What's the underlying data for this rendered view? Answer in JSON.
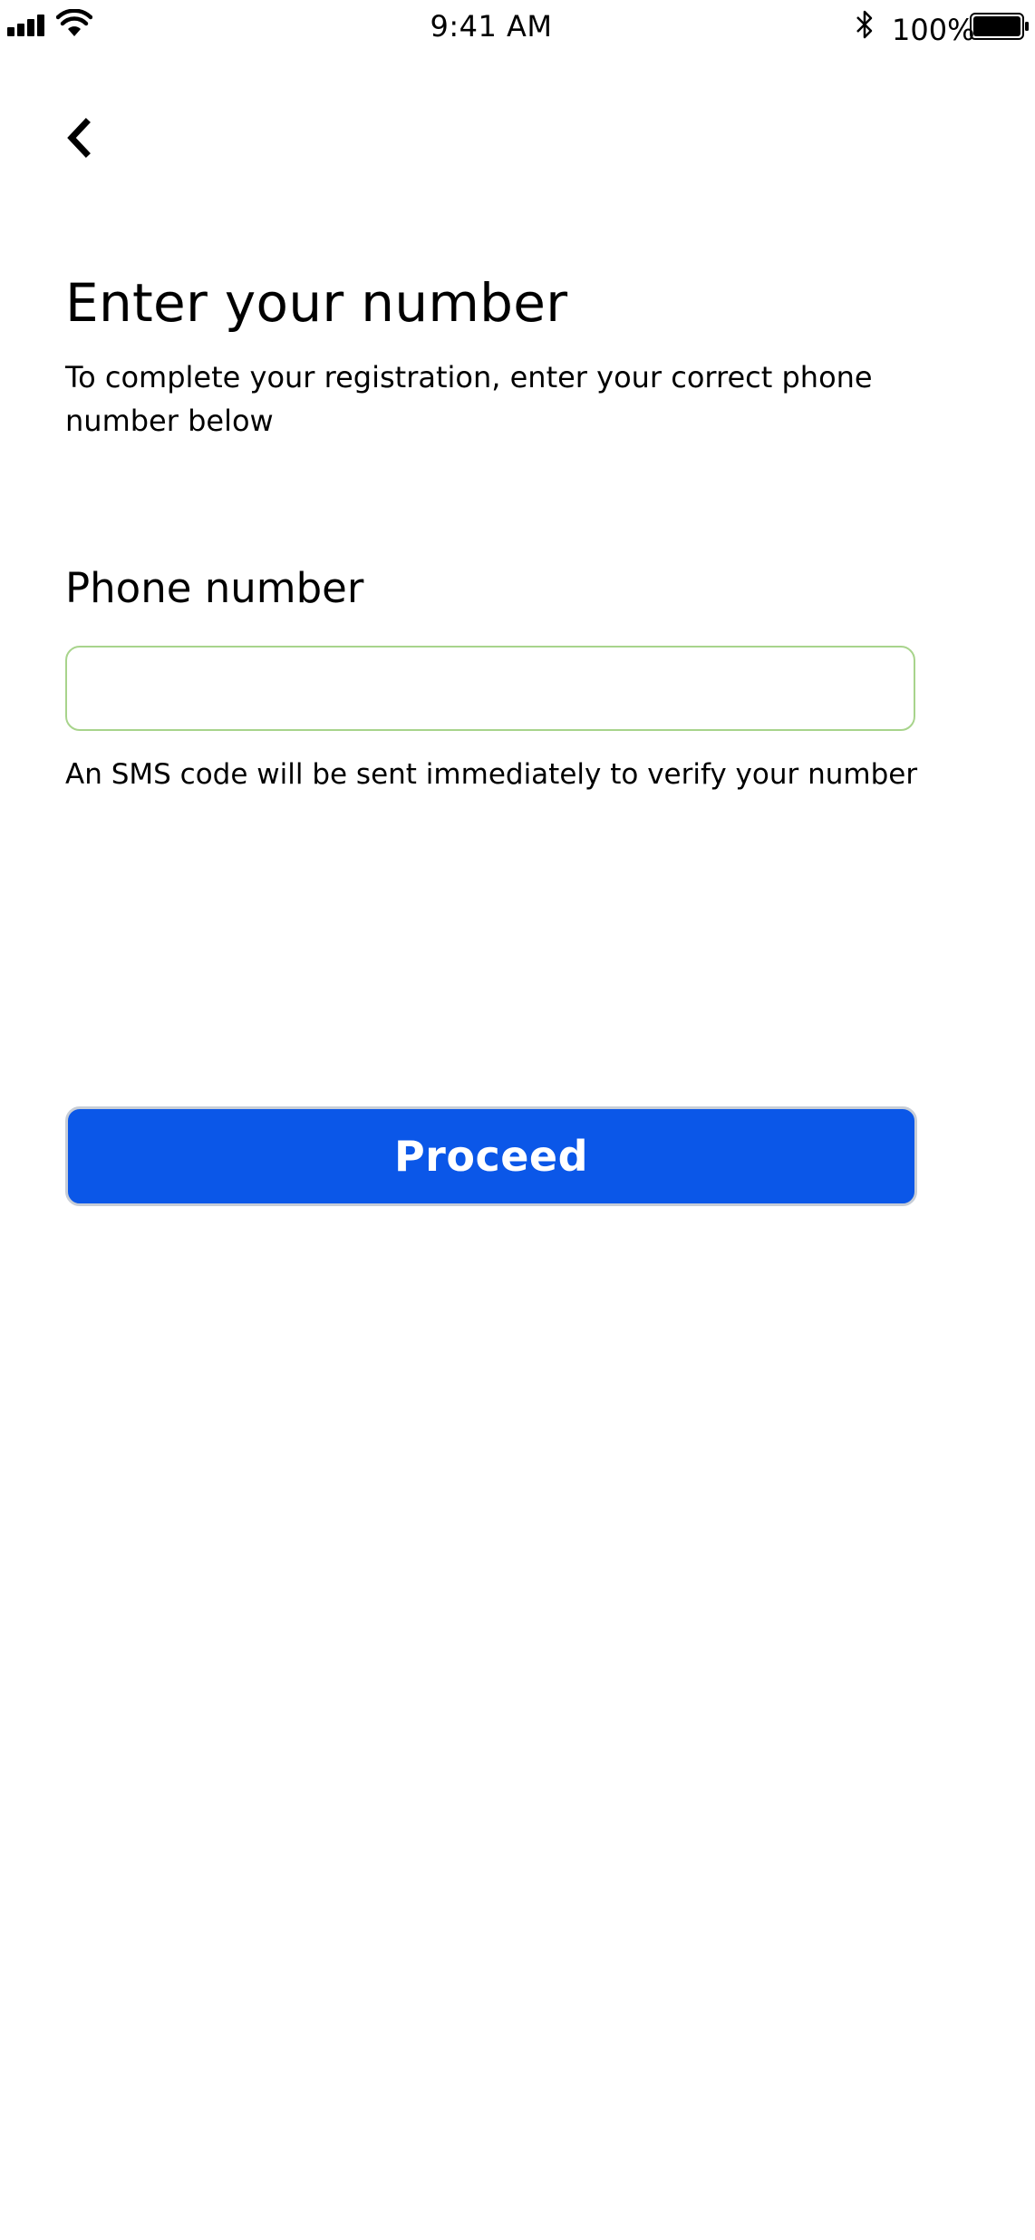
{
  "status_bar": {
    "time": "9:41 AM",
    "battery_percent": "100%",
    "signal_icon": "cellular-signal-icon",
    "wifi_icon": "wifi-icon",
    "bluetooth_icon": "bluetooth-icon",
    "battery_icon": "battery-icon",
    "battery_level": 1.0
  },
  "nav": {
    "back_icon": "chevron-left-icon"
  },
  "header": {
    "title": "Enter your number",
    "subtitle": "To complete your registration, enter your correct phone number below"
  },
  "form": {
    "phone_label": "Phone number",
    "phone_value": "",
    "phone_placeholder": "",
    "helper": "An SMS code will be sent immediately to verify your number",
    "input_border_color": "#a8d48c"
  },
  "actions": {
    "proceed_label": "Proceed",
    "proceed_color": "#0b57e8"
  }
}
